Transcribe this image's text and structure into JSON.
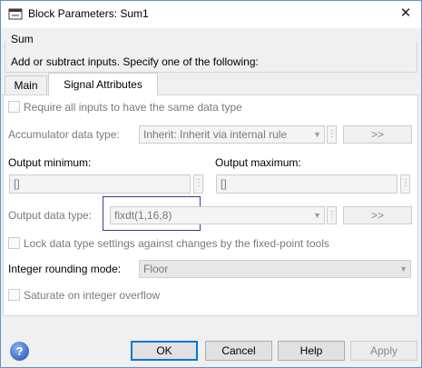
{
  "window": {
    "title": "Block Parameters: Sum1",
    "close_glyph": "✕"
  },
  "group": {
    "title": "Sum",
    "description": "Add or subtract inputs.  Specify one of the following:"
  },
  "tabs": [
    {
      "label": "Main",
      "selected": false
    },
    {
      "label": "Signal Attributes",
      "selected": true
    }
  ],
  "signal_attributes": {
    "require_same_type_label": "Require all inputs to have the same data type",
    "accumulator_label": "Accumulator data type:",
    "accumulator_value": "Inherit: Inherit via internal rule",
    "output_min_label": "Output minimum:",
    "output_min_value": "[]",
    "output_max_label": "Output maximum:",
    "output_max_value": "[]",
    "output_type_label": "Output data type:",
    "output_type_value": "fixdt(1,16,8)",
    "assistant_label": ">>",
    "dots_glyph": "⋮",
    "lock_label": "Lock data type settings against changes by the fixed-point tools",
    "rounding_label": "Integer rounding mode:",
    "rounding_value": "Floor",
    "saturate_label": "Saturate on integer overflow"
  },
  "buttons": {
    "ok": "OK",
    "cancel": "Cancel",
    "help": "Help",
    "apply": "Apply"
  },
  "icons": {
    "help": "?",
    "app": "simulink-block-icon",
    "dropdown": "▼"
  }
}
